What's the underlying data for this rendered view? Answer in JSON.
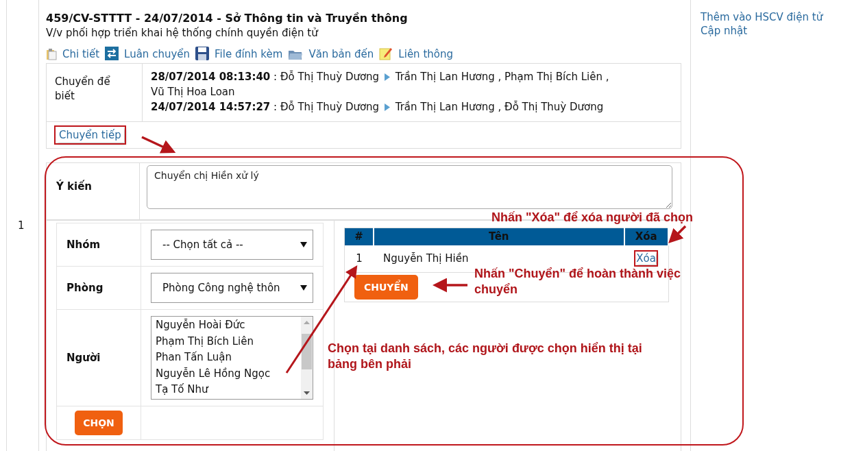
{
  "document": {
    "row_number": "1",
    "title": "459/CV-STTTT - 24/07/2014 - Sở Thông tin và Truyền thông",
    "subject": "V/v phối hợp triển khai hệ thống chính quyền điện tử",
    "toolbar": [
      {
        "label": "Chi tiết",
        "kind": "clipboard"
      },
      {
        "label": "Luân chuyển",
        "kind": "swap"
      },
      {
        "label": "File đính kèm",
        "kind": "disk"
      },
      {
        "label": "Văn bản đến",
        "kind": "folder"
      },
      {
        "label": "Liên thông",
        "kind": "note"
      }
    ]
  },
  "history": {
    "label": "Chuyển để biết",
    "entries": [
      {
        "time": "28/07/2014 08:13:40",
        "separator": ":",
        "sender": "Đỗ Thị Thuỳ Dương",
        "recipients": "Trần Thị Lan Hương , Phạm Thị Bích Liên , Vũ Thị Hoa Loan"
      },
      {
        "time": "24/07/2014 14:57:27",
        "separator": ":",
        "sender": "Đỗ Thị Thuỳ Dương",
        "recipients": "Trần Thị Lan Hương , Đỗ Thị Thuỳ Dương"
      }
    ]
  },
  "forward_link": {
    "label": "Chuyển tiếp",
    "highlighted": true
  },
  "form": {
    "comment_label": "Ý kiến",
    "comment": "Chuyển chị Hiền xử lý",
    "group_label": "Nhóm",
    "group_value": "-- Chọn tất cả --",
    "department_label": "Phòng",
    "department_value": "Phòng Công nghệ thôn",
    "person_label": "Người",
    "people": [
      "Nguyễn Hoài Đức",
      "Phạm Thị Bích Liên",
      "Phan Tấn Luận",
      "Nguyễn Lê Hồng Ngọc",
      "Tạ Tố Như"
    ],
    "choose_button": "CHỌN"
  },
  "selected_table": {
    "columns": [
      "#",
      "Tên",
      "Xóa"
    ],
    "rows": [
      {
        "index": "1",
        "name": "Nguyễn Thị Hiền",
        "action": "Xóa",
        "highlighted": true
      }
    ],
    "send_button": "CHUYỂN"
  },
  "side_links": [
    "Thêm vào HSCV điện tử",
    "Cập nhật"
  ],
  "annotations": [
    {
      "text": "Nhấn \"Xóa\" để xóa người đã chọn"
    },
    {
      "text": "Nhấn \"Chuyển\" để hoàn thành việc chuyển"
    },
    {
      "text": "Chọn tại danh sách, các người được chọn hiển thị tại bảng bên phải"
    }
  ]
}
